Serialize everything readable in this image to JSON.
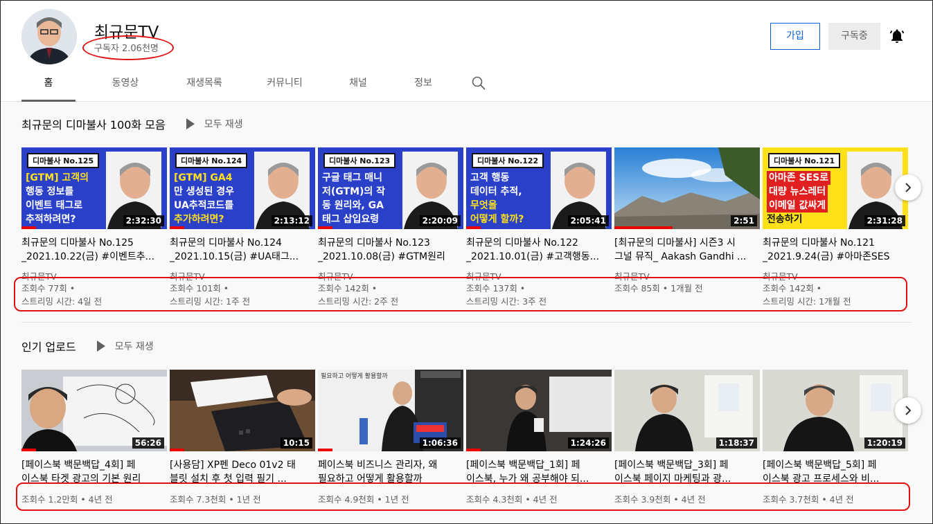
{
  "channel": {
    "name": "최규문TV",
    "subscribers": "구독자 2.06천명",
    "join_label": "가입",
    "subscribed_label": "구독중",
    "bell_icon": "bell-icon"
  },
  "tabs": [
    {
      "label": "홈",
      "active": true
    },
    {
      "label": "동영상"
    },
    {
      "label": "재생목록"
    },
    {
      "label": "커뮤니티"
    },
    {
      "label": "채널"
    },
    {
      "label": "정보"
    }
  ],
  "shelves": [
    {
      "title": "최규문의 디마불사 100화 모음",
      "play_all": "모두 재생",
      "videos": [
        {
          "badge": "디마불사 No.125",
          "thumb_lines": [
            "[GTM] 고객의",
            "행동 정보를",
            "이벤트 태그로",
            "추적하려면?"
          ],
          "duration": "2:32:30",
          "progress": 0.1,
          "title_1": "최규문의 디마불사 No.125",
          "title_2": "_2021.10.22(금) #이벤트추...",
          "channel": "최규문TV",
          "views": "조회수 77회 •",
          "when": "스트리밍 시간: 4일 전"
        },
        {
          "badge": "디마불사 No.124",
          "thumb_lines": [
            "[GTM] GA4",
            "만 생성된 경우",
            "UA추적코드를",
            "추가하려면?"
          ],
          "duration": "2:13:12",
          "progress": 0.1,
          "title_1": "최규문의 디마불사 No.124",
          "title_2": "_2021.10.15(금) #UA태그...",
          "channel": "최규문TV",
          "views": "조회수 101회 •",
          "when": "스트리밍 시간: 1주 전"
        },
        {
          "badge": "디마불사 No.123",
          "thumb_lines": [
            "구글 태그 매니",
            "저(GTM)의 작",
            "동 원리와, GA",
            "태그 삽입요령"
          ],
          "duration": "2:20:09",
          "progress": 0.1,
          "title_1": "최규문의 디마불사 No.123",
          "title_2": "_2021.10.08(금) #GTM원리",
          "channel": "최규문TV",
          "views": "조회수 142회 •",
          "when": "스트리밍 시간: 2주 전"
        },
        {
          "badge": "디마불사 No.122",
          "thumb_lines": [
            "고객 행동",
            "데이터 추적,",
            "무엇을",
            "어떻게 할까?"
          ],
          "duration": "2:05:41",
          "progress": 0.1,
          "title_1": "최규문의 디마불사 No.122",
          "title_2": "_2021.10.01(금) #고객행동...",
          "channel": "최규문TV",
          "views": "조회수 137회 •",
          "when": "스트리밍 시간: 3주 전"
        },
        {
          "badge": "",
          "thumb_lines": [],
          "duration": "2:51",
          "progress": 0.4,
          "title_1": "[최규문의 디마불사] 시즌3 시",
          "title_2": "그널 뮤직_ Aakash Gandhi ...",
          "channel": "최규문TV",
          "views": "조회수 85회 • 1개월 전",
          "when": ""
        },
        {
          "badge": "디마불사 No.121",
          "thumb_lines": [
            "아마존 SES로",
            "대량 뉴스레터",
            "이메일 값싸게",
            "전송하기"
          ],
          "duration": "2:31:28",
          "progress": 0,
          "title_1": "최규문의 디마불사 No.121",
          "title_2": "_2021.9.24(금) #아마존SES",
          "channel": "최규문TV",
          "views": "조회수 142회 •",
          "when": "스트리밍 시간: 1개월 전"
        }
      ]
    },
    {
      "title": "인기 업로드",
      "play_all": "모두 재생",
      "videos": [
        {
          "duration": "56:26",
          "progress": 0.1,
          "title_1": "[페이스북 백문백답_4회] 페",
          "title_2": "이스북 타겟 광고의 기본 원리",
          "views": "조회수 1.2만회 • 4년 전"
        },
        {
          "duration": "10:15",
          "progress": 0.1,
          "title_1": "[사용담] XP펜 Deco 01v2 태",
          "title_2": "블릿 설치 후 첫 입력 필기 ...",
          "views": "조회수 7.3천회 • 1년 전"
        },
        {
          "duration": "1:06:36",
          "progress": 0.1,
          "title_1": "페이스북 비즈니스 관리자, 왜",
          "title_2": "필요하고 어떻게 활용할까",
          "views": "조회수 4.9천회 • 1년 전",
          "thumb_text": "필요하고 어떻게 활용할까"
        },
        {
          "duration": "1:24:26",
          "progress": 0.1,
          "title_1": "[페이스북 백문백답_1회] 페",
          "title_2": "이스북, 누가 왜 공부해야 되...",
          "views": "조회수 4.3천회 • 4년 전"
        },
        {
          "duration": "1:18:37",
          "progress": 0,
          "title_1": "[페이스북 백문백답_3회] 페",
          "title_2": "이스북 페이지 마케팅과 광...",
          "views": "조회수 3.9천회 • 4년 전"
        },
        {
          "duration": "1:20:19",
          "progress": 0,
          "title_1": "[페이스북 백문백답_5회] 페",
          "title_2": "이스북 광고 프로세스와 비...",
          "views": "조회수 3.7천회 • 4년 전"
        }
      ]
    }
  ],
  "colors": {
    "accent_blue": "#065fd4",
    "thumb_blue": "#2a40c9",
    "thumb_yellow": "#ffe119",
    "annotation_red": "#e01010",
    "progress_red": "#ee0000"
  }
}
